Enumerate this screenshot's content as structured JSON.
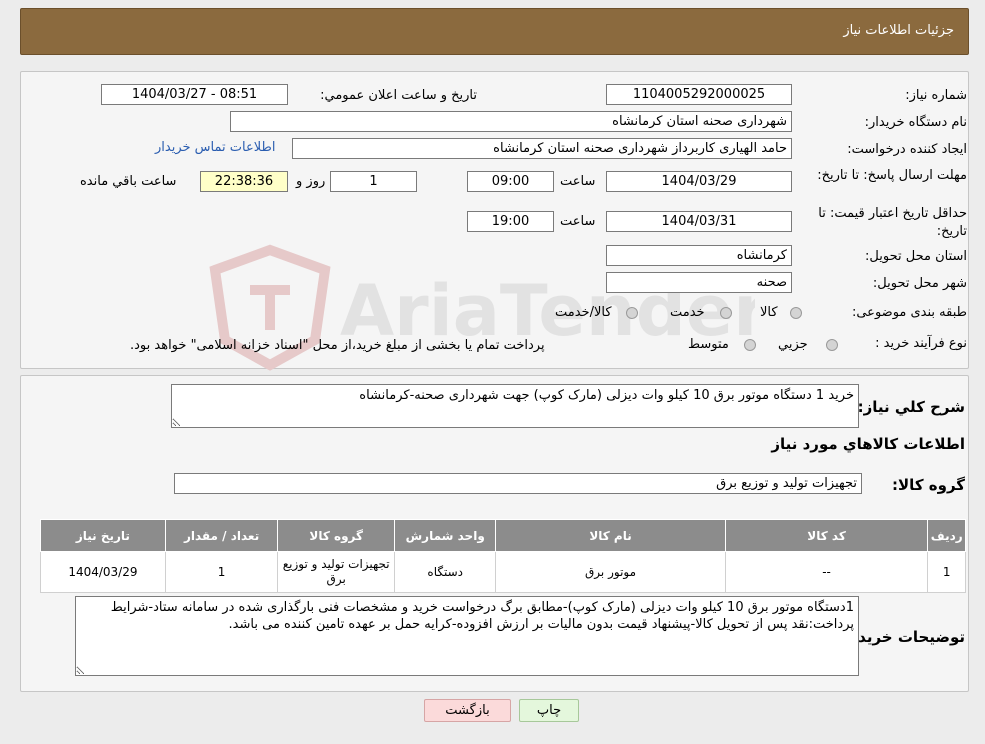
{
  "header": {
    "title": "جزئیات اطلاعات نیاز"
  },
  "form": {
    "need_number_label": "شماره نیاز:",
    "need_number": "1104005292000025",
    "announce_label": "تاریخ و ساعت اعلان عمومي:",
    "announce_value": "1404/03/27 - 08:51",
    "buyer_label": "نام دستگاه خريدار:",
    "buyer_value": "شهرداری صحنه استان کرمانشاه",
    "creator_label": "ايجاد كننده درخواست:",
    "creator_value": "حامد الهیاری کاربرداز شهرداری صحنه استان کرمانشاه",
    "contact_link": "اطلاعات تماس خريدار",
    "deadline_label": "مهلت ارسال پاسخ: تا تاريخ:",
    "deadline_date": "1404/03/29",
    "time_label": "ساعت",
    "deadline_time": "09:00",
    "days_value": "1",
    "days_label": "روز و",
    "remaining_time": "22:38:36",
    "remaining_label": "ساعت باقي مانده",
    "validity_label": "حداقل تاريخ اعتبار قيمت: تا تاريخ:",
    "validity_date": "1404/03/31",
    "validity_time": "19:00",
    "province_label": "استان محل تحويل:",
    "province_value": "کرمانشاه",
    "city_label": "شهر محل تحويل:",
    "city_value": "صحنه",
    "category_label": "طبقه بندی موضوعی:",
    "category_options": [
      "كالا",
      "خدمت",
      "كالا/خدمت"
    ],
    "process_label": "نوع فرآيند خريد :",
    "process_options": [
      "جزيي",
      "متوسط"
    ],
    "process_note": "پرداخت تمام يا بخشی از مبلغ خريد،از محل \"اسناد خزانه اسلامی\" خواهد بود."
  },
  "summary": {
    "desc_label": "شرح كلي نياز:",
    "desc_value": "خرید 1 دستگاه موتور برق 10 کیلو وات دیزلی (مارک کوپ) جهت شهرداری صحنه-کرمانشاه",
    "goods_info_title": "اطلاعات كالاهاي مورد نياز",
    "group_label": "گروه كالا:",
    "group_value": "تجهیزات تولید و توزیع برق"
  },
  "table": {
    "headers": [
      "رديف",
      "كد كالا",
      "نام كالا",
      "واحد شمارش",
      "گروه كالا",
      "تعداد / مقدار",
      "تاريخ نياز"
    ],
    "rows": [
      [
        "1",
        "--",
        "موتور برق",
        "دستگاه",
        "تجهیزات تولید و توزیع برق",
        "1",
        "1404/03/29"
      ]
    ]
  },
  "buyer_notes": {
    "label": "توضيحات خريدار:",
    "value": "1دستگاه موتور برق 10 کیلو وات دیزلی (مارک کوپ)-مطابق برگ درخواست خرید و مشخصات فنی بارگذاری شده در سامانه ستاد-شرایط پرداخت:نقد پس از تحویل کالا-پیشنهاد قیمت بدون مالیات بر ارزش افزوده-کرایه حمل بر عهده تامین کننده می باشد."
  },
  "buttons": {
    "print": "چاپ",
    "back": "بازگشت"
  },
  "watermark": {
    "text": "AriaTender.net"
  },
  "colors": {
    "header_bg": "#8b6a3e",
    "table_header_bg": "#8c8c8c",
    "link": "#2a5db0",
    "time_bg": "#ffffc8"
  }
}
